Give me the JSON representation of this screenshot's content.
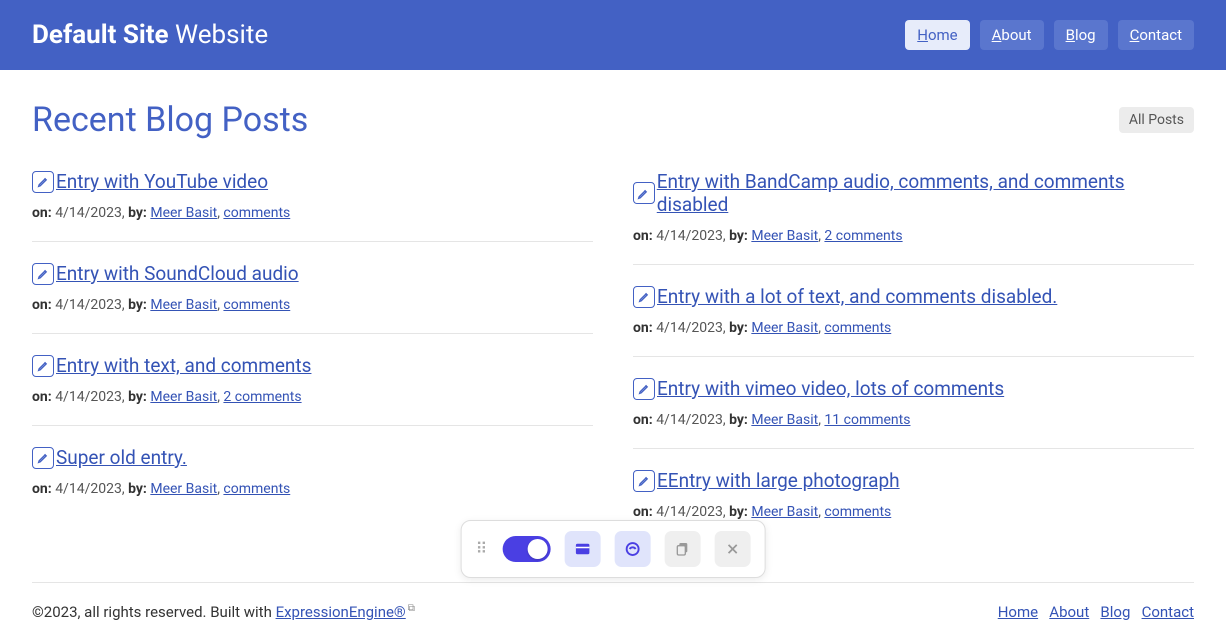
{
  "header": {
    "site_bold": "Default Site",
    "site_rest": " Website",
    "nav": [
      {
        "label": "Home",
        "first": "H",
        "rest": "ome",
        "active": true
      },
      {
        "label": "About",
        "first": "A",
        "rest": "bout",
        "active": false
      },
      {
        "label": "Blog",
        "first": "B",
        "rest": "log",
        "active": false
      },
      {
        "label": "Contact",
        "first": "C",
        "rest": "ontact",
        "active": false
      }
    ]
  },
  "page": {
    "title": "Recent Blog Posts",
    "all_posts": "All Posts"
  },
  "entries_left": [
    {
      "title": "Entry with YouTube video",
      "date": "4/14/2023",
      "author": "Meer Basit",
      "comments": "comments"
    },
    {
      "title": "Entry with SoundCloud audio",
      "date": "4/14/2023",
      "author": "Meer Basit",
      "comments": "comments"
    },
    {
      "title": "Entry with text, and comments",
      "date": "4/14/2023",
      "author": "Meer Basit",
      "comments": "2 comments"
    },
    {
      "title": "Super old entry.",
      "date": "4/14/2023",
      "author": "Meer Basit",
      "comments": "comments"
    }
  ],
  "entries_right": [
    {
      "title": "Entry with BandCamp audio, comments, and comments disabled",
      "date": "4/14/2023",
      "author": "Meer Basit",
      "comments": "2 comments"
    },
    {
      "title": "Entry with a lot of text, and comments disabled.",
      "date": "4/14/2023",
      "author": "Meer Basit",
      "comments": "comments"
    },
    {
      "title": "Entry with vimeo video, lots of comments",
      "date": "4/14/2023",
      "author": "Meer Basit",
      "comments": "11 comments"
    },
    {
      "title": "EEntry with large photograph",
      "date": "4/14/2023",
      "author": "Meer Basit",
      "comments": "comments"
    }
  ],
  "meta": {
    "on_label": "on:",
    "by_label": "by:",
    "sep": ", "
  },
  "footer": {
    "copyright": "©2023, all rights reserved. Built with ",
    "ee": "ExpressionEngine®",
    "links": [
      "Home",
      "About",
      "Blog",
      "Contact"
    ]
  }
}
